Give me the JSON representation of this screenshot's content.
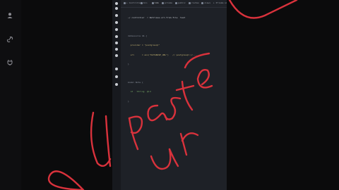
{
  "tabs": [
    {
      "label": "▸ Controller"
    },
    {
      "label": "bin"
    },
    {
      "label": "lib",
      "active": true
    },
    {
      "label": "prisma"
    },
    {
      "label": "public"
    },
    {
      "label": "routes"
    },
    {
      "label": "views"
    },
    {
      "label": "▸ Prisma"
    },
    {
      "label": "sql"
    }
  ],
  "terminal": {
    "lines": [
      "~/ controller  ∙ Retrieve-url-from-file  test",
      "",
      "datasource db {",
      "  provider = \"postgresql\"",
      "  url      = env(\"DATABASE_URL\")   // postgresql://...",
      "}",
      "",
      "model Note {",
      "  id   String  @id",
      "}"
    ]
  },
  "annotation": {
    "handwriting": "paste ur",
    "color": "#d9323c"
  },
  "colors": {
    "background": "#0b0b0c",
    "editor": "#1e2127"
  }
}
